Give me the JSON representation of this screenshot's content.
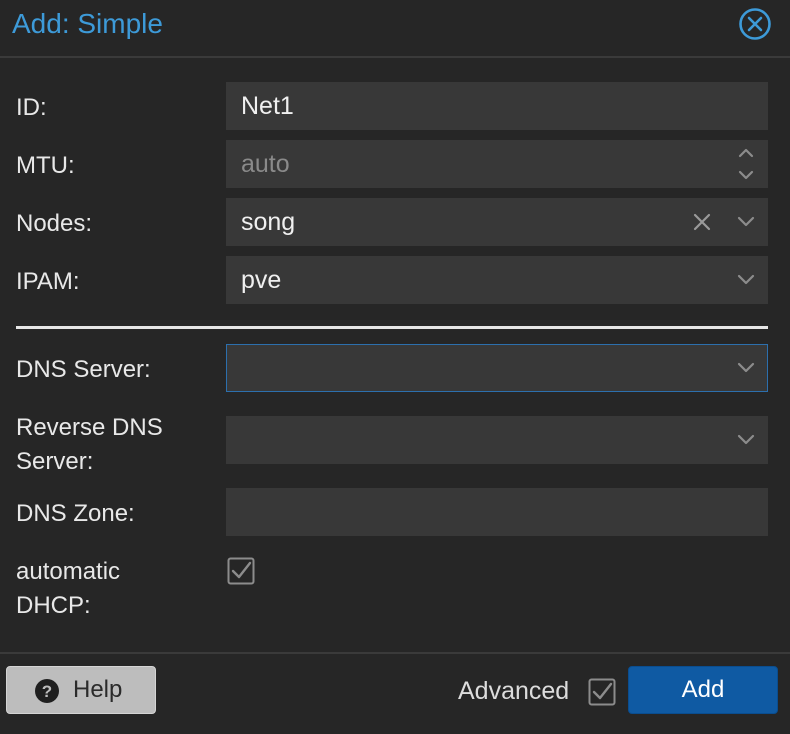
{
  "dialog": {
    "title": "Add: Simple",
    "accent_color": "#3d9ad8"
  },
  "form": {
    "id": {
      "label": "ID:",
      "value": "Net1"
    },
    "mtu": {
      "label": "MTU:",
      "placeholder": "auto"
    },
    "nodes": {
      "label": "Nodes:",
      "value": "song"
    },
    "ipam": {
      "label": "IPAM:",
      "value": "pve"
    },
    "dns_server": {
      "label": "DNS Server:",
      "value": ""
    },
    "reverse_dns_server": {
      "label_line1": "Reverse DNS",
      "label_line2": "Server:",
      "value": ""
    },
    "dns_zone": {
      "label": "DNS Zone:",
      "value": ""
    },
    "automatic_dhcp": {
      "label_line1": "automatic",
      "label_line2": "DHCP:",
      "checked": true
    }
  },
  "footer": {
    "help_label": "Help",
    "advanced_label": "Advanced",
    "advanced_checked": true,
    "add_label": "Add",
    "add_color": "#0f5aa3"
  },
  "icons": {
    "close": "close-circle-icon",
    "help": "question-circle-icon",
    "spinner": "spinner-arrows-icon",
    "clear": "clear-x-icon",
    "dropdown": "chevron-down-icon",
    "checkbox": "checkbox-checked-icon"
  }
}
